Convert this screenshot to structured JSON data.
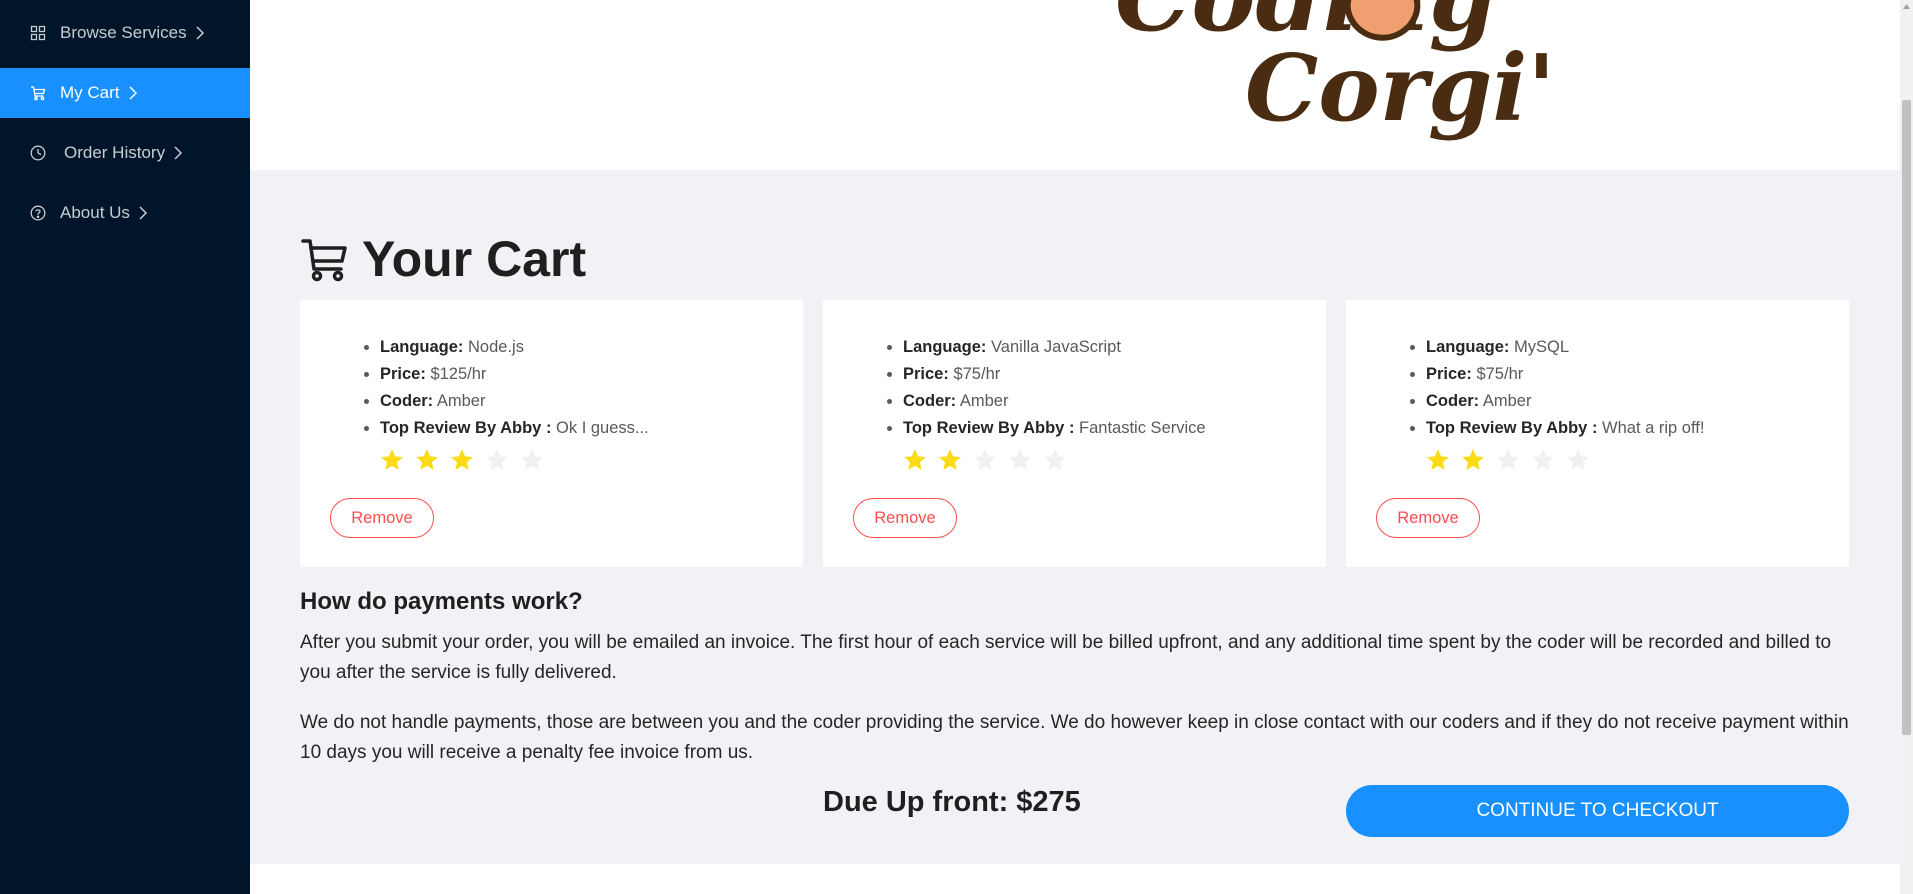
{
  "sidebar": {
    "items": [
      {
        "label": "Browse Services",
        "icon": "grid-icon",
        "active": false
      },
      {
        "label": "My Cart",
        "icon": "cart-icon",
        "active": true
      },
      {
        "label": "Order History",
        "icon": "clock-icon",
        "active": false
      },
      {
        "label": "About Us",
        "icon": "question-circle-icon",
        "active": false
      }
    ]
  },
  "header": {
    "logo_text_line1": "Coding",
    "logo_text_line2": "Corgi's"
  },
  "cart": {
    "title": "Your Cart",
    "field_labels": {
      "language": "Language:",
      "price": "Price:",
      "coder": "Coder:",
      "review": "Top Review By Abby :"
    },
    "items": [
      {
        "language": "Node.js",
        "price": "$125/hr",
        "coder": "Amber",
        "review": "Ok I guess...",
        "rating": 3,
        "remove_label": "Remove"
      },
      {
        "language": "Vanilla JavaScript",
        "price": "$75/hr",
        "coder": "Amber",
        "review": "Fantastic Service",
        "rating": 2,
        "remove_label": "Remove"
      },
      {
        "language": "MySQL",
        "price": "$75/hr",
        "coder": "Amber",
        "review": "What a rip off!",
        "rating": 2,
        "remove_label": "Remove"
      }
    ]
  },
  "payments": {
    "heading": "How do payments work?",
    "paragraph1": "After you submit your order, you will be emailed an invoice. The first hour of each service will be billed upfront, and any additional time spent by the coder will be recorded and billed to you after the service is fully delivered.",
    "paragraph2": "We do not handle payments, those are between you and the coder providing the service. We do however keep in close contact with our coders and if they do not receive payment within 10 days you will receive a penalty fee invoice from us."
  },
  "summary": {
    "due_text": "Due Up front: $275",
    "checkout_label": "CONTINUE TO CHECKOUT"
  },
  "colors": {
    "sidebar_bg": "#001529",
    "accent": "#1890ff",
    "danger": "#ff4d4f",
    "star_filled": "#fadb14",
    "star_empty": "#f0f0f0",
    "logo_brown": "#4a2c12",
    "logo_orange": "#f0a070"
  }
}
